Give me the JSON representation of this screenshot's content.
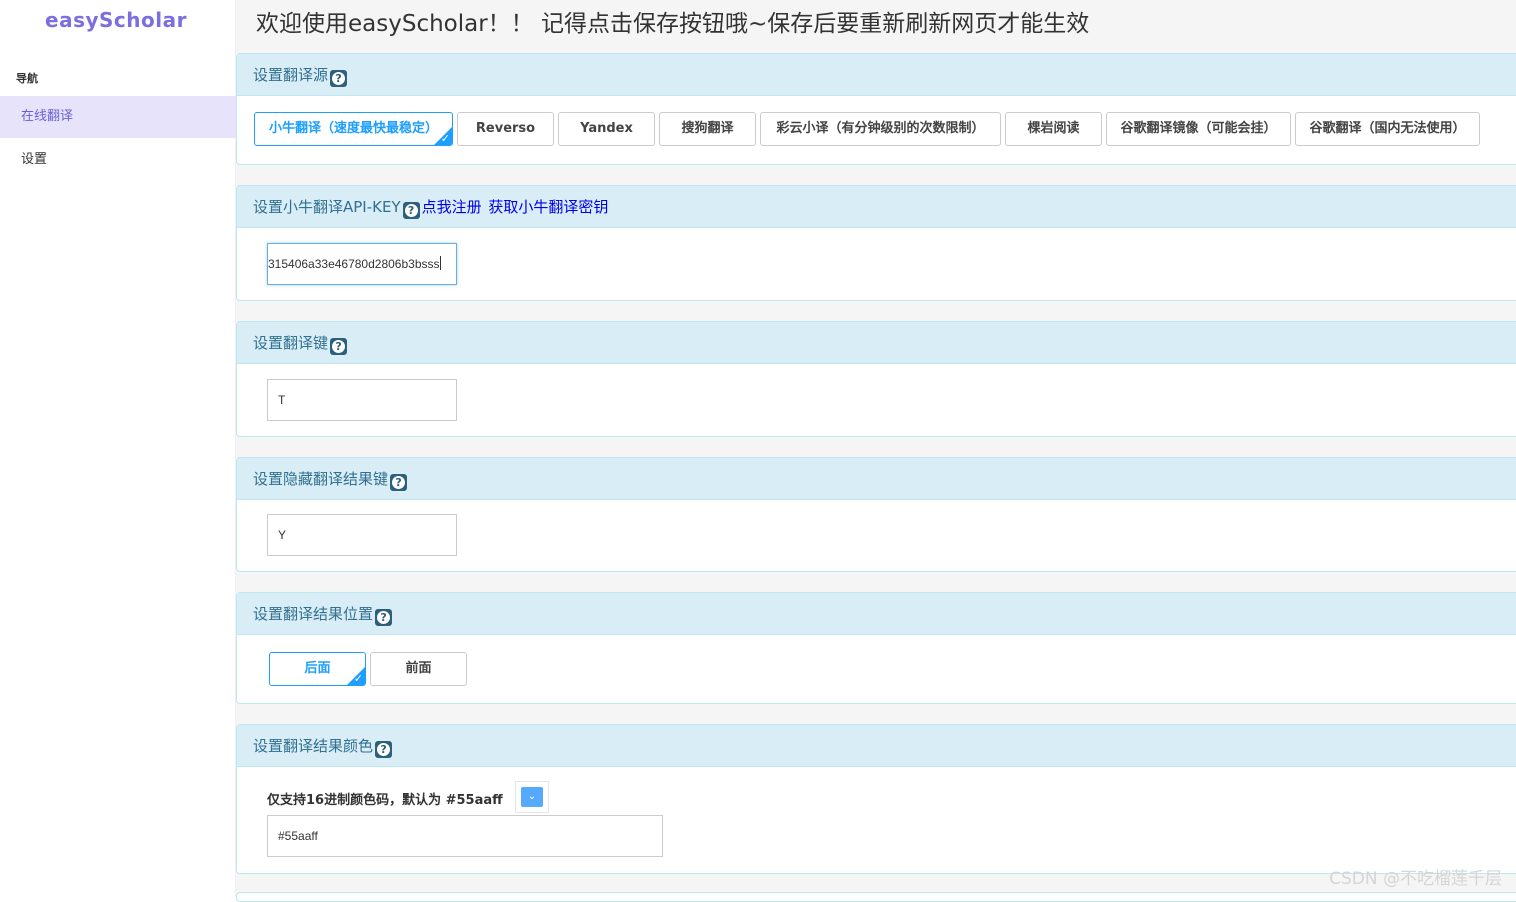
{
  "sidebar": {
    "logo": "easyScholar",
    "heading": "导航",
    "items": [
      {
        "label": "在线翻译"
      },
      {
        "label": "设置"
      }
    ]
  },
  "header": {
    "title": "欢迎使用easyScholar！！ 记得点击保存按钮哦~保存后要重新刷新网页才能生效"
  },
  "source_panel": {
    "title": "设置翻译源",
    "options": [
      {
        "label": "小牛翻译（速度最快最稳定）",
        "selected": true
      },
      {
        "label": "Reverso",
        "selected": false
      },
      {
        "label": "Yandex",
        "selected": false
      },
      {
        "label": "搜狗翻译",
        "selected": false
      },
      {
        "label": "彩云小译（有分钟级别的次数限制）",
        "selected": false
      },
      {
        "label": "棵岩阅读",
        "selected": false
      },
      {
        "label": "谷歌翻译镜像（可能会挂）",
        "selected": false
      },
      {
        "label": "谷歌翻译（国内无法使用）",
        "selected": false
      }
    ]
  },
  "apikey_panel": {
    "title": "设置小牛翻译API-KEY",
    "link1": "点我注册",
    "link2": "获取小牛翻译密钥",
    "value": "315406a33e46780d2806b3bsss"
  },
  "key_panel": {
    "title": "设置翻译键",
    "value": "T"
  },
  "hide_panel": {
    "title": "设置隐藏翻译结果键",
    "value": "Y"
  },
  "position_panel": {
    "title": "设置翻译结果位置",
    "options": [
      {
        "label": "后面",
        "selected": true
      },
      {
        "label": "前面",
        "selected": false
      }
    ]
  },
  "color_panel": {
    "title": "设置翻译结果颜色",
    "note": "仅支持16进制颜色码，默认为 #55aaff",
    "value": "#55aaff",
    "swatch_color": "#55aaff"
  },
  "help_icon_glyph": "?",
  "checkmark_glyph": "✓",
  "dropdown_glyph": "⌄",
  "watermark": "CSDN @不吃榴莲千层",
  "colors": {
    "accent": "#1e9fff",
    "logo": "#7b6ee0",
    "nav_active_bg": "#e6e3fb",
    "panel_heading_bg": "#d9edf7",
    "panel_heading_text": "#31708f"
  }
}
